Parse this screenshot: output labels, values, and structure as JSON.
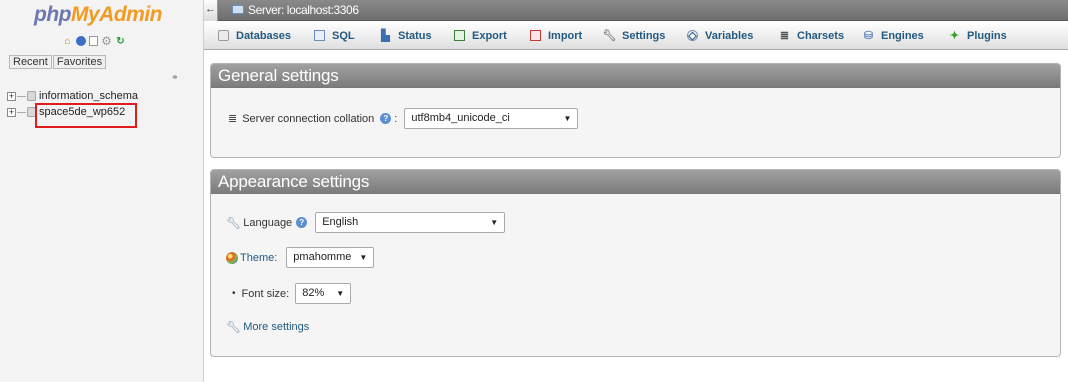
{
  "navigation": {
    "logo": {
      "part1": "php",
      "part2": "MyAdmin"
    },
    "icons": [
      "home-icon",
      "exit-icon",
      "docs-icon",
      "settings-icon",
      "reload-icon"
    ],
    "tabs": [
      "Recent",
      "Favorites"
    ],
    "databases": [
      {
        "expander": "+",
        "name": "information_schema"
      },
      {
        "expander": "+",
        "name": "space5de_wp652"
      }
    ],
    "highlight_color": "#e21c1c"
  },
  "topbar": {
    "collapse_symbol": "←",
    "server_label": "Server: localhost:3306"
  },
  "menu": {
    "tabs": [
      {
        "label": "Databases",
        "icon": "database-icon"
      },
      {
        "label": "SQL",
        "icon": "sql-icon"
      },
      {
        "label": "Status",
        "icon": "status-icon"
      },
      {
        "label": "Export",
        "icon": "export-icon"
      },
      {
        "label": "Import",
        "icon": "import-icon"
      },
      {
        "label": "Settings",
        "icon": "wrench-icon"
      },
      {
        "label": "Variables",
        "icon": "variables-icon"
      },
      {
        "label": "Charsets",
        "icon": "charsets-icon"
      },
      {
        "label": "Engines",
        "icon": "engines-icon"
      },
      {
        "label": "Plugins",
        "icon": "plugins-icon"
      }
    ]
  },
  "general_settings": {
    "title": "General settings",
    "collation": {
      "label": "Server connection collation",
      "suffix": ":",
      "value": "utf8mb4_unicode_ci"
    }
  },
  "appearance_settings": {
    "title": "Appearance settings",
    "language": {
      "label": "Language",
      "value": "English"
    },
    "theme": {
      "label": "Theme:",
      "value": "pmahomme"
    },
    "font_size": {
      "label": "Font size:",
      "value": "82%"
    },
    "more_settings": "More settings"
  },
  "colors": {
    "brand_blue": "#6c78af",
    "brand_orange": "#f29a22",
    "link": "#235a81",
    "header_gray": "#8a8a8a"
  }
}
